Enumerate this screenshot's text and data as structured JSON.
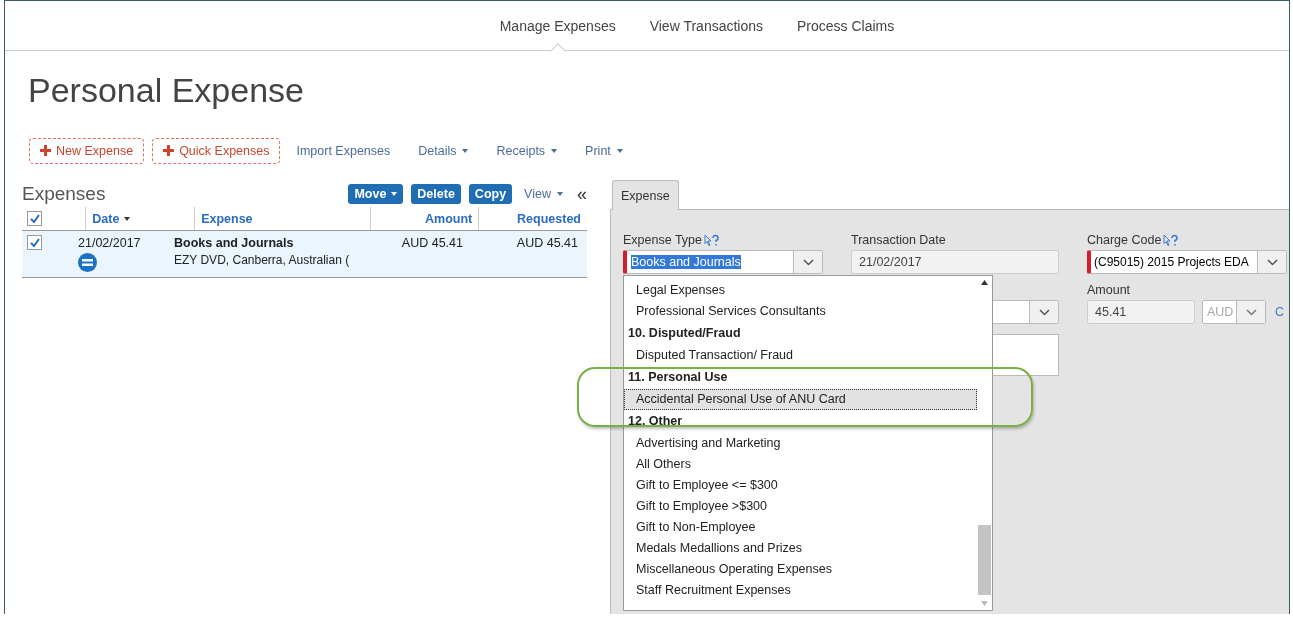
{
  "nav": [
    {
      "label": "Manage Expenses",
      "selected": true
    },
    {
      "label": "View Transactions",
      "selected": false
    },
    {
      "label": "Process Claims",
      "selected": false
    }
  ],
  "page_title": "Personal Expense",
  "toolbar": [
    {
      "label": "New Expense",
      "kind": "add"
    },
    {
      "label": "Quick Expenses",
      "kind": "add"
    },
    {
      "label": "Import Expenses",
      "kind": "link"
    },
    {
      "label": "Details",
      "kind": "menu"
    },
    {
      "label": "Receipts",
      "kind": "menu"
    },
    {
      "label": "Print",
      "kind": "menu"
    }
  ],
  "expenses": {
    "title": "Expenses",
    "buttons": [
      {
        "label": "Move",
        "kind": "menu"
      },
      {
        "label": "Delete",
        "kind": "plain"
      },
      {
        "label": "Copy",
        "kind": "plain"
      }
    ],
    "view_menu": "View",
    "collapse": "«",
    "all_checked": true,
    "columns": [
      {
        "label": "Date",
        "sorted": true
      },
      {
        "label": "Expense",
        "sorted": false
      },
      {
        "label": "Amount",
        "sorted": false
      },
      {
        "label": "Requested",
        "sorted": false
      }
    ],
    "rows": [
      {
        "checked": true,
        "selected": true,
        "date": "21/02/2017",
        "type": "Books and Journals",
        "description": "EZY DVD, Canberra, Australian (",
        "amount": "AUD 45.41",
        "requested": "AUD 45.41"
      }
    ]
  },
  "form": {
    "tab": {
      "label": "Expense",
      "selected": true
    },
    "expense_type": {
      "label": "Expense Type",
      "value": "Books and Journals"
    },
    "transaction_date": {
      "label": "Transaction Date",
      "value": "21/02/2017"
    },
    "charge_code": {
      "label": "Charge Code",
      "value": "(C95015) 2015 Projects EDA"
    },
    "amount": {
      "label": "Amount",
      "value": "45.41",
      "currency": "AUD",
      "link": "C"
    },
    "dropdown": [
      {
        "kind": "option",
        "label": "Legal Expenses",
        "selected": false
      },
      {
        "kind": "option",
        "label": "Professional Services Consultants",
        "selected": false
      },
      {
        "kind": "heading",
        "label": "10. Disputed/Fraud"
      },
      {
        "kind": "option",
        "label": "Disputed Transaction/ Fraud",
        "selected": false
      },
      {
        "kind": "heading",
        "label": "11. Personal Use"
      },
      {
        "kind": "option",
        "label": "Accidental Personal Use of ANU Card",
        "selected": true
      },
      {
        "kind": "heading",
        "label": "12. Other"
      },
      {
        "kind": "option",
        "label": "Advertising and Marketing",
        "selected": false
      },
      {
        "kind": "option",
        "label": "All Others",
        "selected": false
      },
      {
        "kind": "option",
        "label": "Gift to Employee <= $300",
        "selected": false
      },
      {
        "kind": "option",
        "label": "Gift to Employee >$300",
        "selected": false
      },
      {
        "kind": "option",
        "label": "Gift to Non-Employee",
        "selected": false
      },
      {
        "kind": "option",
        "label": "Medals Medallions and Prizes",
        "selected": false
      },
      {
        "kind": "option",
        "label": "Miscellaneous Operating Expenses",
        "selected": false
      },
      {
        "kind": "option",
        "label": "Staff Recruitment Expenses",
        "selected": false
      }
    ]
  }
}
